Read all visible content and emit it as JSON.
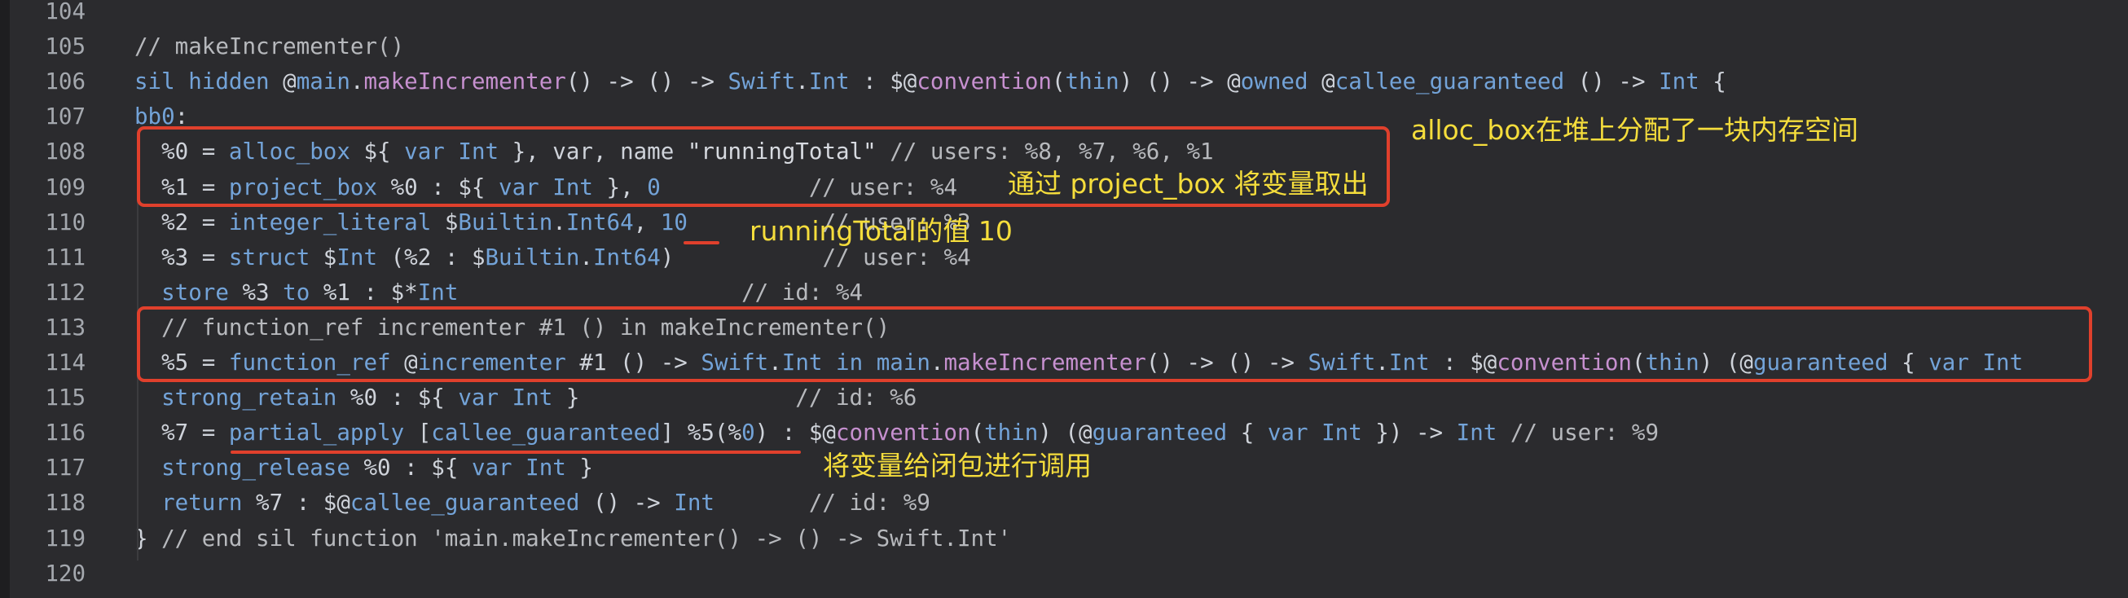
{
  "editor": {
    "lines": [
      {
        "num": "104",
        "segments": []
      },
      {
        "num": "105",
        "segments": [
          {
            "c": "c",
            "t": "// makeIncrementer()"
          }
        ]
      },
      {
        "num": "106",
        "segments": [
          {
            "c": "k",
            "t": "sil"
          },
          {
            "c": "p",
            "t": " "
          },
          {
            "c": "k",
            "t": "hidden"
          },
          {
            "c": "p",
            "t": " @"
          },
          {
            "c": "t",
            "t": "main"
          },
          {
            "c": "p",
            "t": "."
          },
          {
            "c": "f",
            "t": "makeIncrementer"
          },
          {
            "c": "p",
            "t": "() -> () -> "
          },
          {
            "c": "t",
            "t": "Swift"
          },
          {
            "c": "p",
            "t": "."
          },
          {
            "c": "t",
            "t": "Int"
          },
          {
            "c": "p",
            "t": " : $@"
          },
          {
            "c": "f",
            "t": "convention"
          },
          {
            "c": "p",
            "t": "("
          },
          {
            "c": "k",
            "t": "thin"
          },
          {
            "c": "p",
            "t": ") () -> @"
          },
          {
            "c": "k",
            "t": "owned"
          },
          {
            "c": "p",
            "t": " @"
          },
          {
            "c": "k",
            "t": "callee_guaranteed"
          },
          {
            "c": "p",
            "t": " () -> "
          },
          {
            "c": "t",
            "t": "Int"
          },
          {
            "c": "p",
            "t": " {"
          }
        ]
      },
      {
        "num": "107",
        "segments": [
          {
            "c": "k",
            "t": "bb0"
          },
          {
            "c": "p",
            "t": ":"
          }
        ]
      },
      {
        "num": "108",
        "segments": [
          {
            "c": "p",
            "t": "  %0 = "
          },
          {
            "c": "k",
            "t": "alloc_box"
          },
          {
            "c": "p",
            "t": " ${ "
          },
          {
            "c": "k",
            "t": "var"
          },
          {
            "c": "p",
            "t": " "
          },
          {
            "c": "t",
            "t": "Int"
          },
          {
            "c": "p",
            "t": " }, var, name "
          },
          {
            "c": "s",
            "t": "\"runningTotal\""
          },
          {
            "c": "p",
            "t": " "
          },
          {
            "c": "c",
            "t": "// users: %8, %7, %6, %1"
          }
        ]
      },
      {
        "num": "109",
        "segments": [
          {
            "c": "p",
            "t": "  %1 = "
          },
          {
            "c": "k",
            "t": "project_box"
          },
          {
            "c": "p",
            "t": " %0 : ${ "
          },
          {
            "c": "k",
            "t": "var"
          },
          {
            "c": "p",
            "t": " "
          },
          {
            "c": "t",
            "t": "Int"
          },
          {
            "c": "p",
            "t": " }, "
          },
          {
            "c": "n",
            "t": "0"
          },
          {
            "c": "p",
            "t": "           "
          },
          {
            "c": "c",
            "t": "// user: %4"
          }
        ]
      },
      {
        "num": "110",
        "segments": [
          {
            "c": "p",
            "t": "  %2 = "
          },
          {
            "c": "k",
            "t": "integer_literal"
          },
          {
            "c": "p",
            "t": " $"
          },
          {
            "c": "t",
            "t": "Builtin"
          },
          {
            "c": "p",
            "t": "."
          },
          {
            "c": "t",
            "t": "Int64"
          },
          {
            "c": "p",
            "t": ", "
          },
          {
            "c": "n",
            "t": "10"
          },
          {
            "c": "p",
            "t": "          "
          },
          {
            "c": "c",
            "t": "// user: %3"
          }
        ]
      },
      {
        "num": "111",
        "segments": [
          {
            "c": "p",
            "t": "  %3 = "
          },
          {
            "c": "k",
            "t": "struct"
          },
          {
            "c": "p",
            "t": " $"
          },
          {
            "c": "t",
            "t": "Int"
          },
          {
            "c": "p",
            "t": " (%2 : $"
          },
          {
            "c": "t",
            "t": "Builtin"
          },
          {
            "c": "p",
            "t": "."
          },
          {
            "c": "t",
            "t": "Int64"
          },
          {
            "c": "p",
            "t": ")           "
          },
          {
            "c": "c",
            "t": "// user: %4"
          }
        ]
      },
      {
        "num": "112",
        "segments": [
          {
            "c": "p",
            "t": "  "
          },
          {
            "c": "k",
            "t": "store"
          },
          {
            "c": "p",
            "t": " %3 "
          },
          {
            "c": "k",
            "t": "to"
          },
          {
            "c": "p",
            "t": " %1 : $*"
          },
          {
            "c": "t",
            "t": "Int"
          },
          {
            "c": "p",
            "t": "                     "
          },
          {
            "c": "c",
            "t": "// id: %4"
          }
        ]
      },
      {
        "num": "113",
        "segments": [
          {
            "c": "c",
            "t": "  // function_ref incrementer #1 () in makeIncrementer()"
          }
        ]
      },
      {
        "num": "114",
        "segments": [
          {
            "c": "p",
            "t": "  %5 = "
          },
          {
            "c": "k",
            "t": "function_ref"
          },
          {
            "c": "p",
            "t": " @"
          },
          {
            "c": "t",
            "t": "incrementer"
          },
          {
            "c": "p",
            "t": " #1 () -> "
          },
          {
            "c": "t",
            "t": "Swift"
          },
          {
            "c": "p",
            "t": "."
          },
          {
            "c": "t",
            "t": "Int"
          },
          {
            "c": "p",
            "t": " "
          },
          {
            "c": "k",
            "t": "in"
          },
          {
            "c": "p",
            "t": " "
          },
          {
            "c": "t",
            "t": "main"
          },
          {
            "c": "p",
            "t": "."
          },
          {
            "c": "f",
            "t": "makeIncrementer"
          },
          {
            "c": "p",
            "t": "() -> () -> "
          },
          {
            "c": "t",
            "t": "Swift"
          },
          {
            "c": "p",
            "t": "."
          },
          {
            "c": "t",
            "t": "Int"
          },
          {
            "c": "p",
            "t": " : $@"
          },
          {
            "c": "f",
            "t": "convention"
          },
          {
            "c": "p",
            "t": "("
          },
          {
            "c": "k",
            "t": "thin"
          },
          {
            "c": "p",
            "t": ") (@"
          },
          {
            "c": "k",
            "t": "guaranteed"
          },
          {
            "c": "p",
            "t": " { "
          },
          {
            "c": "k",
            "t": "var"
          },
          {
            "c": "p",
            "t": " "
          },
          {
            "c": "t",
            "t": "Int"
          }
        ]
      },
      {
        "num": "115",
        "segments": [
          {
            "c": "p",
            "t": "  "
          },
          {
            "c": "k",
            "t": "strong_retain"
          },
          {
            "c": "p",
            "t": " %0 : ${ "
          },
          {
            "c": "k",
            "t": "var"
          },
          {
            "c": "p",
            "t": " "
          },
          {
            "c": "t",
            "t": "Int"
          },
          {
            "c": "p",
            "t": " }                "
          },
          {
            "c": "c",
            "t": "// id: %6"
          }
        ]
      },
      {
        "num": "116",
        "segments": [
          {
            "c": "p",
            "t": "  %7 = "
          },
          {
            "c": "k",
            "t": "partial_apply"
          },
          {
            "c": "p",
            "t": " ["
          },
          {
            "c": "k",
            "t": "callee_guaranteed"
          },
          {
            "c": "p",
            "t": "] %5(%"
          },
          {
            "c": "n",
            "t": "0"
          },
          {
            "c": "p",
            "t": ") : $@"
          },
          {
            "c": "f",
            "t": "convention"
          },
          {
            "c": "p",
            "t": "("
          },
          {
            "c": "k",
            "t": "thin"
          },
          {
            "c": "p",
            "t": ") (@"
          },
          {
            "c": "k",
            "t": "guaranteed"
          },
          {
            "c": "p",
            "t": " { "
          },
          {
            "c": "k",
            "t": "var"
          },
          {
            "c": "p",
            "t": " "
          },
          {
            "c": "t",
            "t": "Int"
          },
          {
            "c": "p",
            "t": " }) -> "
          },
          {
            "c": "t",
            "t": "Int"
          },
          {
            "c": "p",
            "t": " "
          },
          {
            "c": "c",
            "t": "// user: %9"
          }
        ]
      },
      {
        "num": "117",
        "segments": [
          {
            "c": "p",
            "t": "  "
          },
          {
            "c": "k",
            "t": "strong_release"
          },
          {
            "c": "p",
            "t": " %0 : ${ "
          },
          {
            "c": "k",
            "t": "var"
          },
          {
            "c": "p",
            "t": " "
          },
          {
            "c": "t",
            "t": "Int"
          },
          {
            "c": "p",
            "t": " }"
          }
        ]
      },
      {
        "num": "118",
        "segments": [
          {
            "c": "p",
            "t": "  "
          },
          {
            "c": "k",
            "t": "return"
          },
          {
            "c": "p",
            "t": " %7 : $@"
          },
          {
            "c": "k",
            "t": "callee_guaranteed"
          },
          {
            "c": "p",
            "t": " () -> "
          },
          {
            "c": "t",
            "t": "Int"
          },
          {
            "c": "p",
            "t": "       "
          },
          {
            "c": "c",
            "t": "// id: %9"
          }
        ]
      },
      {
        "num": "119",
        "segments": [
          {
            "c": "p",
            "t": "} "
          },
          {
            "c": "c",
            "t": "// end sil function 'main.makeIncrementer() -> () -> Swift.Int'"
          }
        ]
      },
      {
        "num": "120",
        "segments": []
      }
    ]
  },
  "annotations": {
    "alloc_box": "alloc_box在堆上分配了一块内存空间",
    "project_box": "通过 project_box 将变量取出",
    "running_total": "runningTotal的值 10",
    "partial_apply": "将变量给闭包进行调用"
  },
  "colors": {
    "background": "#2b2b2e",
    "keyword": "#73a3d8",
    "function": "#c690cf",
    "comment": "#b7b9bd",
    "highlight_box": "#e0402c",
    "annotation_text": "#f5dd3c"
  }
}
